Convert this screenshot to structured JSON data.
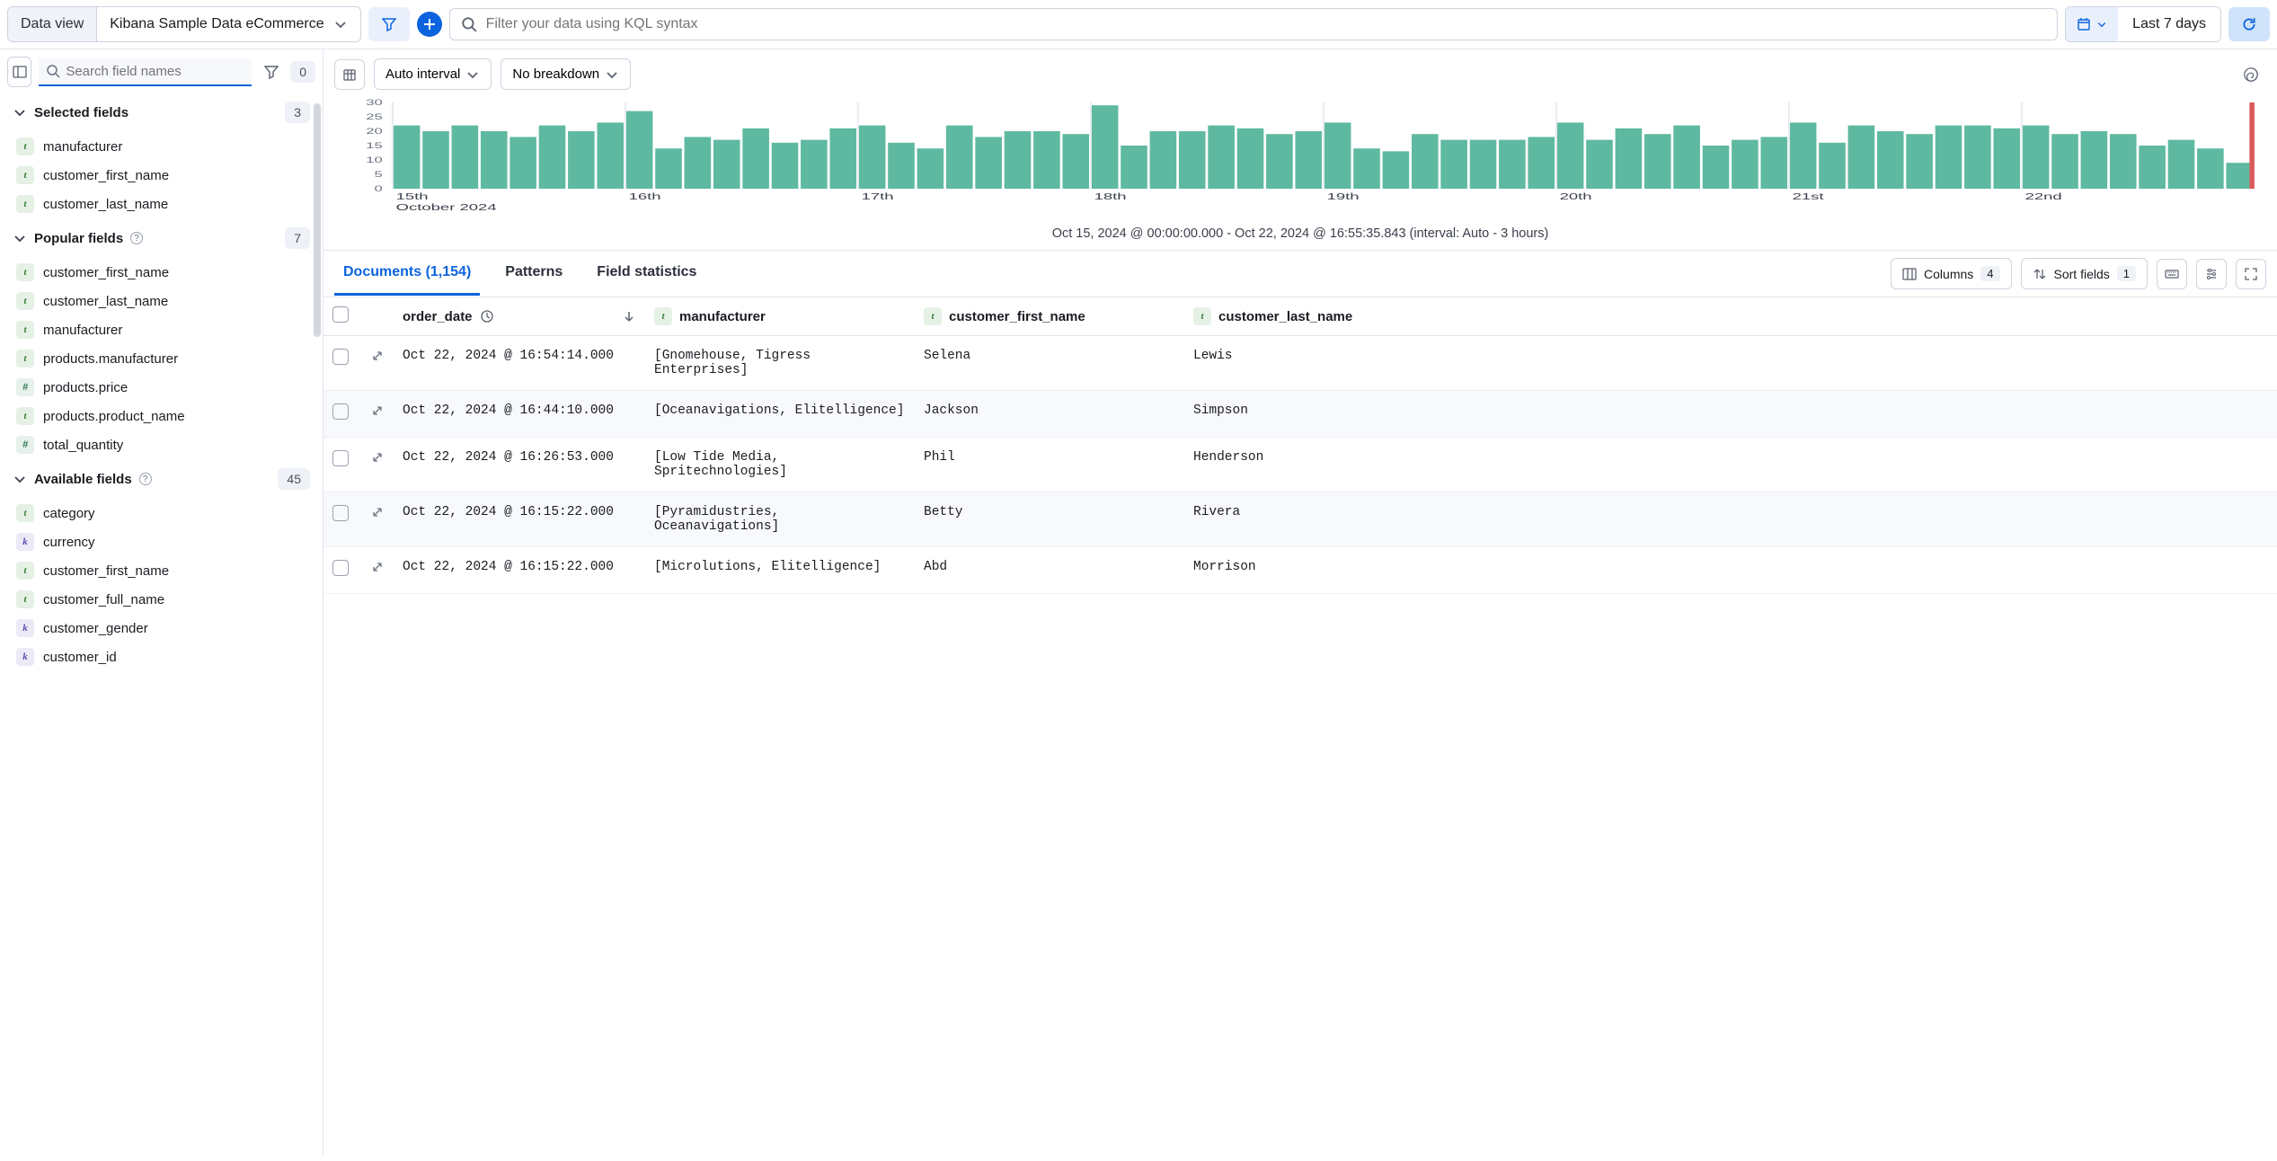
{
  "topbar": {
    "dataview_label": "Data view",
    "dataview_value": "Kibana Sample Data eCommerce",
    "search_placeholder": "Filter your data using KQL syntax",
    "date_label": "Last 7 days"
  },
  "sidebar": {
    "search_placeholder": "Search field names",
    "filter_count": "0",
    "sections": {
      "selected": {
        "title": "Selected fields",
        "count": "3",
        "items": [
          {
            "type": "t",
            "name": "manufacturer"
          },
          {
            "type": "t",
            "name": "customer_first_name"
          },
          {
            "type": "t",
            "name": "customer_last_name"
          }
        ]
      },
      "popular": {
        "title": "Popular fields",
        "count": "7",
        "items": [
          {
            "type": "t",
            "name": "customer_first_name"
          },
          {
            "type": "t",
            "name": "customer_last_name"
          },
          {
            "type": "t",
            "name": "manufacturer"
          },
          {
            "type": "t",
            "name": "products.manufacturer"
          },
          {
            "type": "n",
            "name": "products.price"
          },
          {
            "type": "t",
            "name": "products.product_name"
          },
          {
            "type": "n",
            "name": "total_quantity"
          }
        ]
      },
      "available": {
        "title": "Available fields",
        "count": "45",
        "items": [
          {
            "type": "t",
            "name": "category"
          },
          {
            "type": "k",
            "name": "currency"
          },
          {
            "type": "t",
            "name": "customer_first_name"
          },
          {
            "type": "t",
            "name": "customer_full_name"
          },
          {
            "type": "k",
            "name": "customer_gender"
          },
          {
            "type": "k",
            "name": "customer_id"
          }
        ]
      }
    }
  },
  "histogram": {
    "interval_label": "Auto interval",
    "breakdown_label": "No breakdown",
    "caption": "Oct 15, 2024 @ 00:00:00.000 - Oct 22, 2024 @ 16:55:35.843 (interval: Auto - 3 hours)",
    "y_ticks": [
      "30",
      "25",
      "20",
      "15",
      "10",
      "5",
      "0"
    ],
    "x_ticks": [
      "15th",
      "16th",
      "17th",
      "18th",
      "19th",
      "20th",
      "21st",
      "22nd"
    ],
    "x_sub": "October 2024"
  },
  "tabs": {
    "documents": "Documents (1,154)",
    "patterns": "Patterns",
    "field_stats": "Field statistics",
    "columns_label": "Columns",
    "columns_count": "4",
    "sort_label": "Sort fields",
    "sort_count": "1"
  },
  "table": {
    "headers": {
      "order_date": "order_date",
      "manufacturer": "manufacturer",
      "customer_first_name": "customer_first_name",
      "customer_last_name": "customer_last_name"
    },
    "rows": [
      {
        "date": "Oct 22, 2024 @ 16:54:14.000",
        "manu": "[Gnomehouse, Tigress Enterprises]",
        "fn": "Selena",
        "ln": "Lewis"
      },
      {
        "date": "Oct 22, 2024 @ 16:44:10.000",
        "manu": "[Oceanavigations, Elitelligence]",
        "fn": "Jackson",
        "ln": "Simpson"
      },
      {
        "date": "Oct 22, 2024 @ 16:26:53.000",
        "manu": "[Low Tide Media, Spritechnologies]",
        "fn": "Phil",
        "ln": "Henderson"
      },
      {
        "date": "Oct 22, 2024 @ 16:15:22.000",
        "manu": "[Pyramidustries, Oceanavigations]",
        "fn": "Betty",
        "ln": "Rivera"
      },
      {
        "date": "Oct 22, 2024 @ 16:15:22.000",
        "manu": "[Microlutions, Elitelligence]",
        "fn": "Abd",
        "ln": "Morrison"
      }
    ]
  },
  "chart_data": {
    "type": "bar",
    "title": "",
    "xlabel": "October 2024",
    "ylabel": "",
    "ylim": [
      0,
      30
    ],
    "categories": [
      "15th",
      "",
      "",
      "",
      "",
      "",
      "",
      "",
      "16th",
      "",
      "",
      "",
      "",
      "",
      "",
      "",
      "17th",
      "",
      "",
      "",
      "",
      "",
      "",
      "",
      "18th",
      "",
      "",
      "",
      "",
      "",
      "",
      "",
      "19th",
      "",
      "",
      "",
      "",
      "",
      "",
      "",
      "20th",
      "",
      "",
      "",
      "",
      "",
      "",
      "",
      "21st",
      "",
      "",
      "",
      "",
      "",
      "",
      "",
      "22nd",
      "",
      "",
      "",
      "",
      "",
      "",
      ""
    ],
    "values": [
      22,
      20,
      22,
      20,
      18,
      22,
      20,
      23,
      27,
      14,
      18,
      17,
      21,
      16,
      17,
      21,
      22,
      16,
      14,
      22,
      18,
      20,
      20,
      19,
      29,
      15,
      20,
      20,
      22,
      21,
      19,
      20,
      23,
      14,
      13,
      19,
      17,
      17,
      17,
      18,
      23,
      17,
      21,
      19,
      22,
      15,
      17,
      18,
      23,
      16,
      22,
      20,
      19,
      22,
      22,
      21,
      22,
      19,
      20,
      19,
      15,
      17,
      14,
      9
    ]
  }
}
